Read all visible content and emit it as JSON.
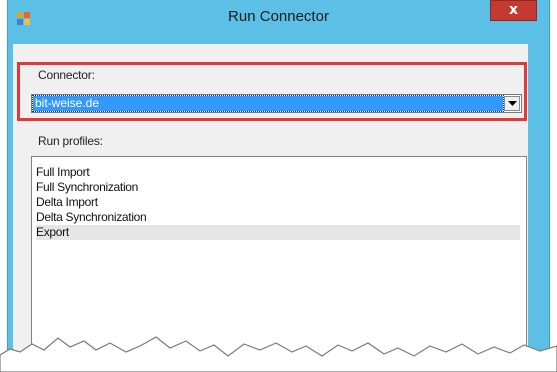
{
  "window": {
    "title": "Run Connector",
    "close_label": "x"
  },
  "connector": {
    "label": "Connector:",
    "selected_value": "bit-weise.de"
  },
  "run_profiles": {
    "label": "Run profiles:",
    "items": [
      "Full Import",
      "Full Synchronization",
      "Delta Import",
      "Delta Synchronization",
      "Export"
    ],
    "selected_item": "Export"
  },
  "colors": {
    "titlebar": "#5cc0e6",
    "close_button": "#c43a30",
    "selection": "#3399ff",
    "highlight_box": "#e0383b"
  },
  "icons": {
    "app": "app-window-icon",
    "dropdown": "chevron-down-icon"
  }
}
